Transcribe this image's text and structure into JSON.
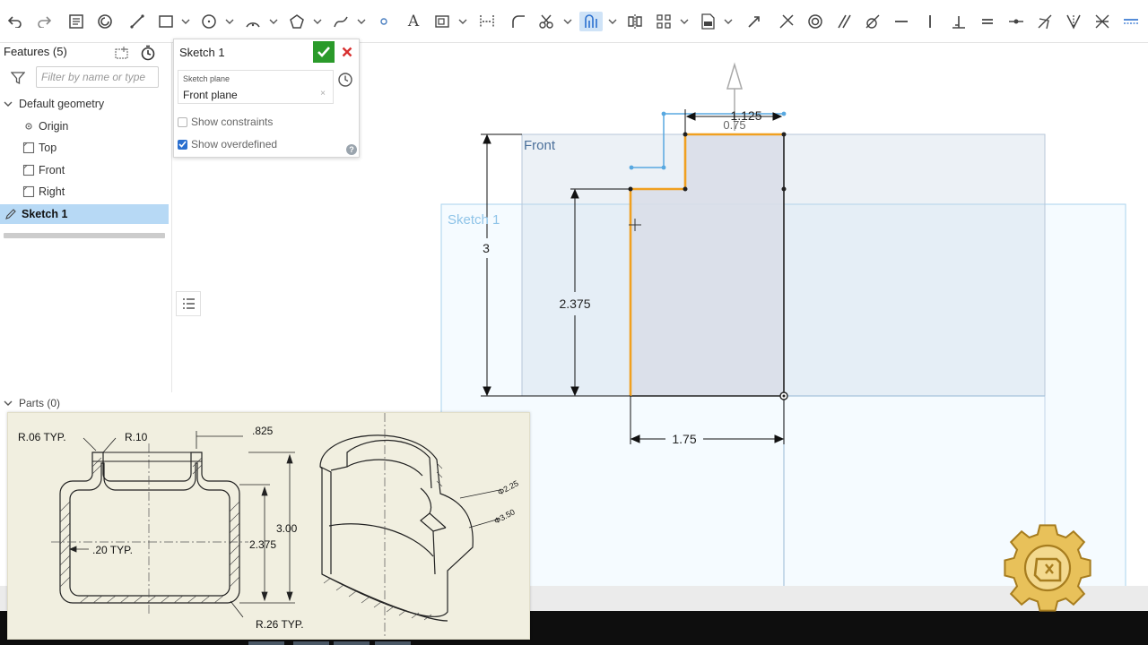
{
  "toolbar": {
    "tools": [
      {
        "name": "undo-icon"
      },
      {
        "name": "redo-icon"
      },
      {
        "name": "new-sketch-icon"
      },
      {
        "name": "use-icon"
      },
      {
        "name": "line-icon"
      },
      {
        "name": "rectangle-icon"
      },
      {
        "name": "circle-icon"
      },
      {
        "name": "arc-icon"
      },
      {
        "name": "polygon-icon"
      },
      {
        "name": "spline-icon"
      },
      {
        "name": "point-icon"
      },
      {
        "name": "text-icon"
      },
      {
        "name": "construction-icon"
      },
      {
        "name": "midpoint-icon"
      },
      {
        "name": "fillet-icon"
      },
      {
        "name": "trim-icon"
      },
      {
        "name": "offset-icon"
      },
      {
        "name": "mirror-icon"
      },
      {
        "name": "pattern-icon"
      },
      {
        "name": "dxf-import-icon"
      },
      {
        "name": "transform-icon"
      },
      {
        "name": "coincident-icon"
      },
      {
        "name": "concentric-icon"
      },
      {
        "name": "parallel-icon"
      },
      {
        "name": "tangent-icon"
      },
      {
        "name": "horizontal-icon"
      },
      {
        "name": "vertical-icon"
      },
      {
        "name": "perpendicular-icon"
      },
      {
        "name": "equal-icon"
      },
      {
        "name": "midpoint-constraint-icon"
      },
      {
        "name": "normal-icon"
      },
      {
        "name": "pierce-icon"
      },
      {
        "name": "symmetric-icon"
      },
      {
        "name": "fix-icon"
      }
    ],
    "text_tool_glyph": "A"
  },
  "feature_panel": {
    "title": "Features (5)",
    "filter_placeholder": "Filter by name or type",
    "tree": [
      {
        "label": "Default geometry",
        "kind": "group"
      },
      {
        "label": "Origin",
        "kind": "origin"
      },
      {
        "label": "Top",
        "kind": "plane"
      },
      {
        "label": "Front",
        "kind": "plane"
      },
      {
        "label": "Right",
        "kind": "plane"
      },
      {
        "label": "Sketch 1",
        "kind": "sketch",
        "selected": true
      }
    ],
    "parts_label": "Parts (0)"
  },
  "sketch_dialog": {
    "title": "Sketch 1",
    "plane_label": "Sketch plane",
    "plane_value": "Front plane",
    "plane_clear": "×",
    "show_constraints": {
      "label": "Show constraints",
      "checked": false
    },
    "show_overdefined": {
      "label": "Show overdefined",
      "checked": true
    },
    "help": "?"
  },
  "viewport": {
    "plane_front_label": "Front",
    "plane_sketch_label": "Sketch 1",
    "dimensions": {
      "total_height": "3",
      "step_height": "2.375",
      "width": "1.75",
      "top_width": "1.125",
      "step_width": "0.75"
    }
  },
  "reference_drawing": {
    "notes": {
      "r06": "R.06 TYP.",
      "r10": "R.10",
      "d825": ".825",
      "t20": ".20 TYP.",
      "d2375": "2.375",
      "d300": "3.00",
      "r26": "R.26 TYP.",
      "phi225": "Φ2.25",
      "phi350": "Φ3.50"
    }
  },
  "colors": {
    "accent_blue": "#2a6fcf",
    "selection": "#b7d9f5",
    "sketch_orange": "#f0a020",
    "accept_green": "#2a9a2a",
    "cancel_red": "#d83030"
  }
}
